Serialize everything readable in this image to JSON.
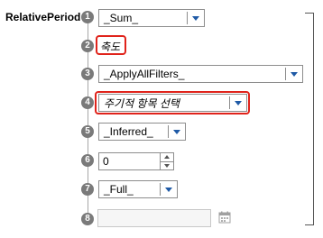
{
  "title": "RelativePeriod",
  "rows": [
    {
      "num": "1",
      "value": "_Sum_"
    },
    {
      "num": "2",
      "value": "축도"
    },
    {
      "num": "3",
      "value": "_ApplyAllFilters_"
    },
    {
      "num": "4",
      "value": "주기적 항목 선택"
    },
    {
      "num": "5",
      "value": "_Inferred_"
    },
    {
      "num": "6",
      "value": "0"
    },
    {
      "num": "7",
      "value": "_Full_"
    },
    {
      "num": "8",
      "value": ""
    }
  ],
  "colors": {
    "badge": "#7a7a7a",
    "highlight": "#e0231b",
    "arrow": "#1f5aa6"
  },
  "icons": {
    "dropdown": "chevron-down-icon",
    "calendar": "calendar-icon"
  }
}
